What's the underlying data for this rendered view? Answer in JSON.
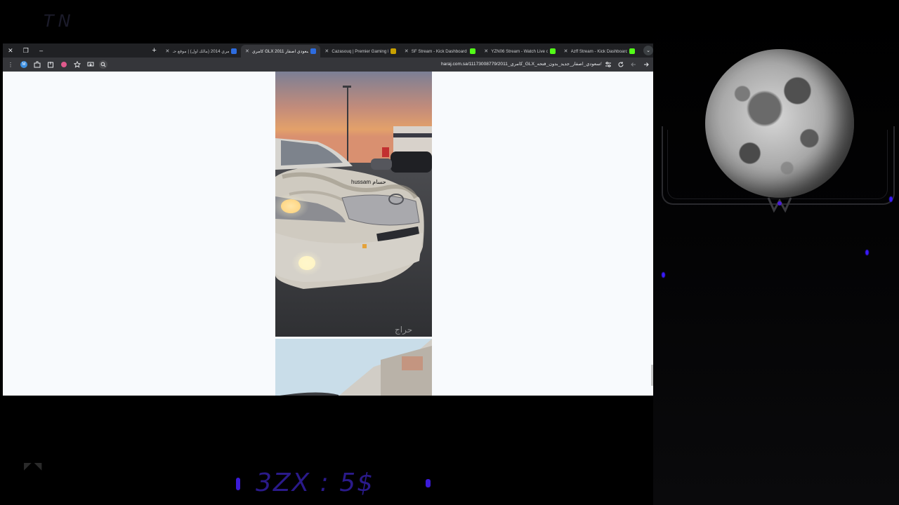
{
  "overlay": {
    "logo_text": "TN",
    "price_text": "3ZX : 5$",
    "arrows": "◤ ◥"
  },
  "window": {
    "controls": {
      "close": "✕",
      "restore": "❐",
      "minimize": "–"
    },
    "new_tab": "+",
    "tab_menu": "⌄",
    "tabs": [
      {
        "title": "كامري 2014 (مالك اول) | موقع حـ",
        "close": "✕",
        "favicon_color": "#2d6cdf",
        "active": false
      },
      {
        "title": "كامري GLX 2011 سعودي اصفار",
        "close": "✕",
        "favicon_color": "#2d6cdf",
        "active": true
      },
      {
        "title": "Cazasouq | Premier Gaming Hu",
        "close": "✕",
        "favicon_color": "#c8a100",
        "active": false
      },
      {
        "title": "SF Stream - Kick Dashboard",
        "close": "✕",
        "favicon_color": "#53fc18",
        "active": false
      },
      {
        "title": "YZN06 Stream - Watch Live on",
        "close": "✕",
        "favicon_color": "#53fc18",
        "active": false
      },
      {
        "title": "Azff Stream - Kick Dashboard",
        "close": "✕",
        "favicon_color": "#53fc18",
        "active": false
      }
    ]
  },
  "toolbar": {
    "menu_icon": "⋮",
    "profile_letter": "M",
    "url": "haraj.com.sa/11173008779/2011_كامري_GLX_سعودي_اصفار_جديد_بدون_فتحه/"
  },
  "content": {
    "photo_caption_text": "hussam حسام",
    "watermark": "حراج"
  },
  "colors": {
    "browser_frame": "#202124",
    "toolbar": "#35363a",
    "page_bg": "#f8fafd",
    "accent_purple": "#3b1bd8"
  }
}
